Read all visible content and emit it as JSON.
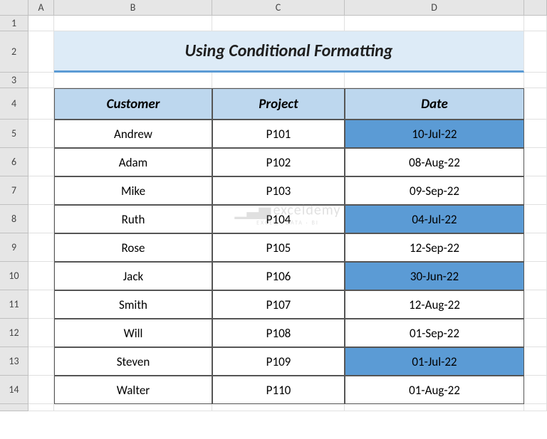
{
  "columns": [
    "A",
    "B",
    "C",
    "D"
  ],
  "row_numbers": [
    "1",
    "2",
    "3",
    "4",
    "5",
    "6",
    "7",
    "8",
    "9",
    "10",
    "11",
    "12",
    "13",
    "14"
  ],
  "title": "Using Conditional Formatting",
  "headers": {
    "customer": "Customer",
    "project": "Project",
    "date": "Date"
  },
  "rows": [
    {
      "customer": "Andrew",
      "project": "P101",
      "date": "10-Jul-22",
      "highlight": true
    },
    {
      "customer": "Adam",
      "project": "P102",
      "date": "08-Aug-22",
      "highlight": false
    },
    {
      "customer": "Mike",
      "project": "P103",
      "date": "09-Sep-22",
      "highlight": false
    },
    {
      "customer": "Ruth",
      "project": "P104",
      "date": "04-Jul-22",
      "highlight": true
    },
    {
      "customer": "Rose",
      "project": "P105",
      "date": "12-Sep-22",
      "highlight": false
    },
    {
      "customer": "Jack",
      "project": "P106",
      "date": "30-Jun-22",
      "highlight": true
    },
    {
      "customer": "Smith",
      "project": "P107",
      "date": "12-Aug-22",
      "highlight": false
    },
    {
      "customer": "Will",
      "project": "P108",
      "date": "01-Sep-22",
      "highlight": false
    },
    {
      "customer": "Steven",
      "project": "P109",
      "date": "01-Jul-22",
      "highlight": true
    },
    {
      "customer": "Walter",
      "project": "P110",
      "date": "01-Aug-22",
      "highlight": false
    }
  ],
  "watermark": {
    "brand": "exceldemy",
    "tagline": "EXCEL · DATA · BI"
  }
}
